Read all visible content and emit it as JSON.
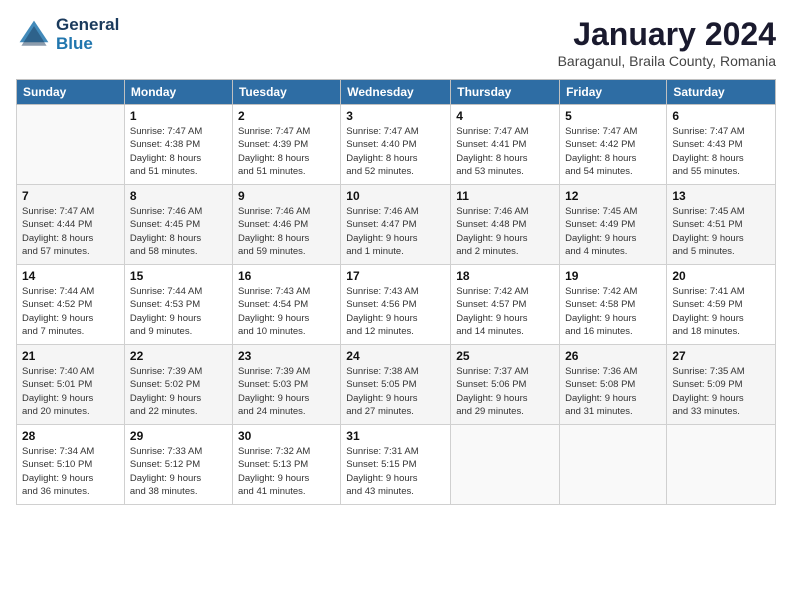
{
  "header": {
    "logo_line1": "General",
    "logo_line2": "Blue",
    "title": "January 2024",
    "subtitle": "Baraganul, Braila County, Romania"
  },
  "calendar": {
    "days_of_week": [
      "Sunday",
      "Monday",
      "Tuesday",
      "Wednesday",
      "Thursday",
      "Friday",
      "Saturday"
    ],
    "weeks": [
      [
        {
          "day": "",
          "info": ""
        },
        {
          "day": "1",
          "info": "Sunrise: 7:47 AM\nSunset: 4:38 PM\nDaylight: 8 hours\nand 51 minutes."
        },
        {
          "day": "2",
          "info": "Sunrise: 7:47 AM\nSunset: 4:39 PM\nDaylight: 8 hours\nand 51 minutes."
        },
        {
          "day": "3",
          "info": "Sunrise: 7:47 AM\nSunset: 4:40 PM\nDaylight: 8 hours\nand 52 minutes."
        },
        {
          "day": "4",
          "info": "Sunrise: 7:47 AM\nSunset: 4:41 PM\nDaylight: 8 hours\nand 53 minutes."
        },
        {
          "day": "5",
          "info": "Sunrise: 7:47 AM\nSunset: 4:42 PM\nDaylight: 8 hours\nand 54 minutes."
        },
        {
          "day": "6",
          "info": "Sunrise: 7:47 AM\nSunset: 4:43 PM\nDaylight: 8 hours\nand 55 minutes."
        }
      ],
      [
        {
          "day": "7",
          "info": "Sunrise: 7:47 AM\nSunset: 4:44 PM\nDaylight: 8 hours\nand 57 minutes."
        },
        {
          "day": "8",
          "info": "Sunrise: 7:46 AM\nSunset: 4:45 PM\nDaylight: 8 hours\nand 58 minutes."
        },
        {
          "day": "9",
          "info": "Sunrise: 7:46 AM\nSunset: 4:46 PM\nDaylight: 8 hours\nand 59 minutes."
        },
        {
          "day": "10",
          "info": "Sunrise: 7:46 AM\nSunset: 4:47 PM\nDaylight: 9 hours\nand 1 minute."
        },
        {
          "day": "11",
          "info": "Sunrise: 7:46 AM\nSunset: 4:48 PM\nDaylight: 9 hours\nand 2 minutes."
        },
        {
          "day": "12",
          "info": "Sunrise: 7:45 AM\nSunset: 4:49 PM\nDaylight: 9 hours\nand 4 minutes."
        },
        {
          "day": "13",
          "info": "Sunrise: 7:45 AM\nSunset: 4:51 PM\nDaylight: 9 hours\nand 5 minutes."
        }
      ],
      [
        {
          "day": "14",
          "info": "Sunrise: 7:44 AM\nSunset: 4:52 PM\nDaylight: 9 hours\nand 7 minutes."
        },
        {
          "day": "15",
          "info": "Sunrise: 7:44 AM\nSunset: 4:53 PM\nDaylight: 9 hours\nand 9 minutes."
        },
        {
          "day": "16",
          "info": "Sunrise: 7:43 AM\nSunset: 4:54 PM\nDaylight: 9 hours\nand 10 minutes."
        },
        {
          "day": "17",
          "info": "Sunrise: 7:43 AM\nSunset: 4:56 PM\nDaylight: 9 hours\nand 12 minutes."
        },
        {
          "day": "18",
          "info": "Sunrise: 7:42 AM\nSunset: 4:57 PM\nDaylight: 9 hours\nand 14 minutes."
        },
        {
          "day": "19",
          "info": "Sunrise: 7:42 AM\nSunset: 4:58 PM\nDaylight: 9 hours\nand 16 minutes."
        },
        {
          "day": "20",
          "info": "Sunrise: 7:41 AM\nSunset: 4:59 PM\nDaylight: 9 hours\nand 18 minutes."
        }
      ],
      [
        {
          "day": "21",
          "info": "Sunrise: 7:40 AM\nSunset: 5:01 PM\nDaylight: 9 hours\nand 20 minutes."
        },
        {
          "day": "22",
          "info": "Sunrise: 7:39 AM\nSunset: 5:02 PM\nDaylight: 9 hours\nand 22 minutes."
        },
        {
          "day": "23",
          "info": "Sunrise: 7:39 AM\nSunset: 5:03 PM\nDaylight: 9 hours\nand 24 minutes."
        },
        {
          "day": "24",
          "info": "Sunrise: 7:38 AM\nSunset: 5:05 PM\nDaylight: 9 hours\nand 27 minutes."
        },
        {
          "day": "25",
          "info": "Sunrise: 7:37 AM\nSunset: 5:06 PM\nDaylight: 9 hours\nand 29 minutes."
        },
        {
          "day": "26",
          "info": "Sunrise: 7:36 AM\nSunset: 5:08 PM\nDaylight: 9 hours\nand 31 minutes."
        },
        {
          "day": "27",
          "info": "Sunrise: 7:35 AM\nSunset: 5:09 PM\nDaylight: 9 hours\nand 33 minutes."
        }
      ],
      [
        {
          "day": "28",
          "info": "Sunrise: 7:34 AM\nSunset: 5:10 PM\nDaylight: 9 hours\nand 36 minutes."
        },
        {
          "day": "29",
          "info": "Sunrise: 7:33 AM\nSunset: 5:12 PM\nDaylight: 9 hours\nand 38 minutes."
        },
        {
          "day": "30",
          "info": "Sunrise: 7:32 AM\nSunset: 5:13 PM\nDaylight: 9 hours\nand 41 minutes."
        },
        {
          "day": "31",
          "info": "Sunrise: 7:31 AM\nSunset: 5:15 PM\nDaylight: 9 hours\nand 43 minutes."
        },
        {
          "day": "",
          "info": ""
        },
        {
          "day": "",
          "info": ""
        },
        {
          "day": "",
          "info": ""
        }
      ]
    ]
  }
}
